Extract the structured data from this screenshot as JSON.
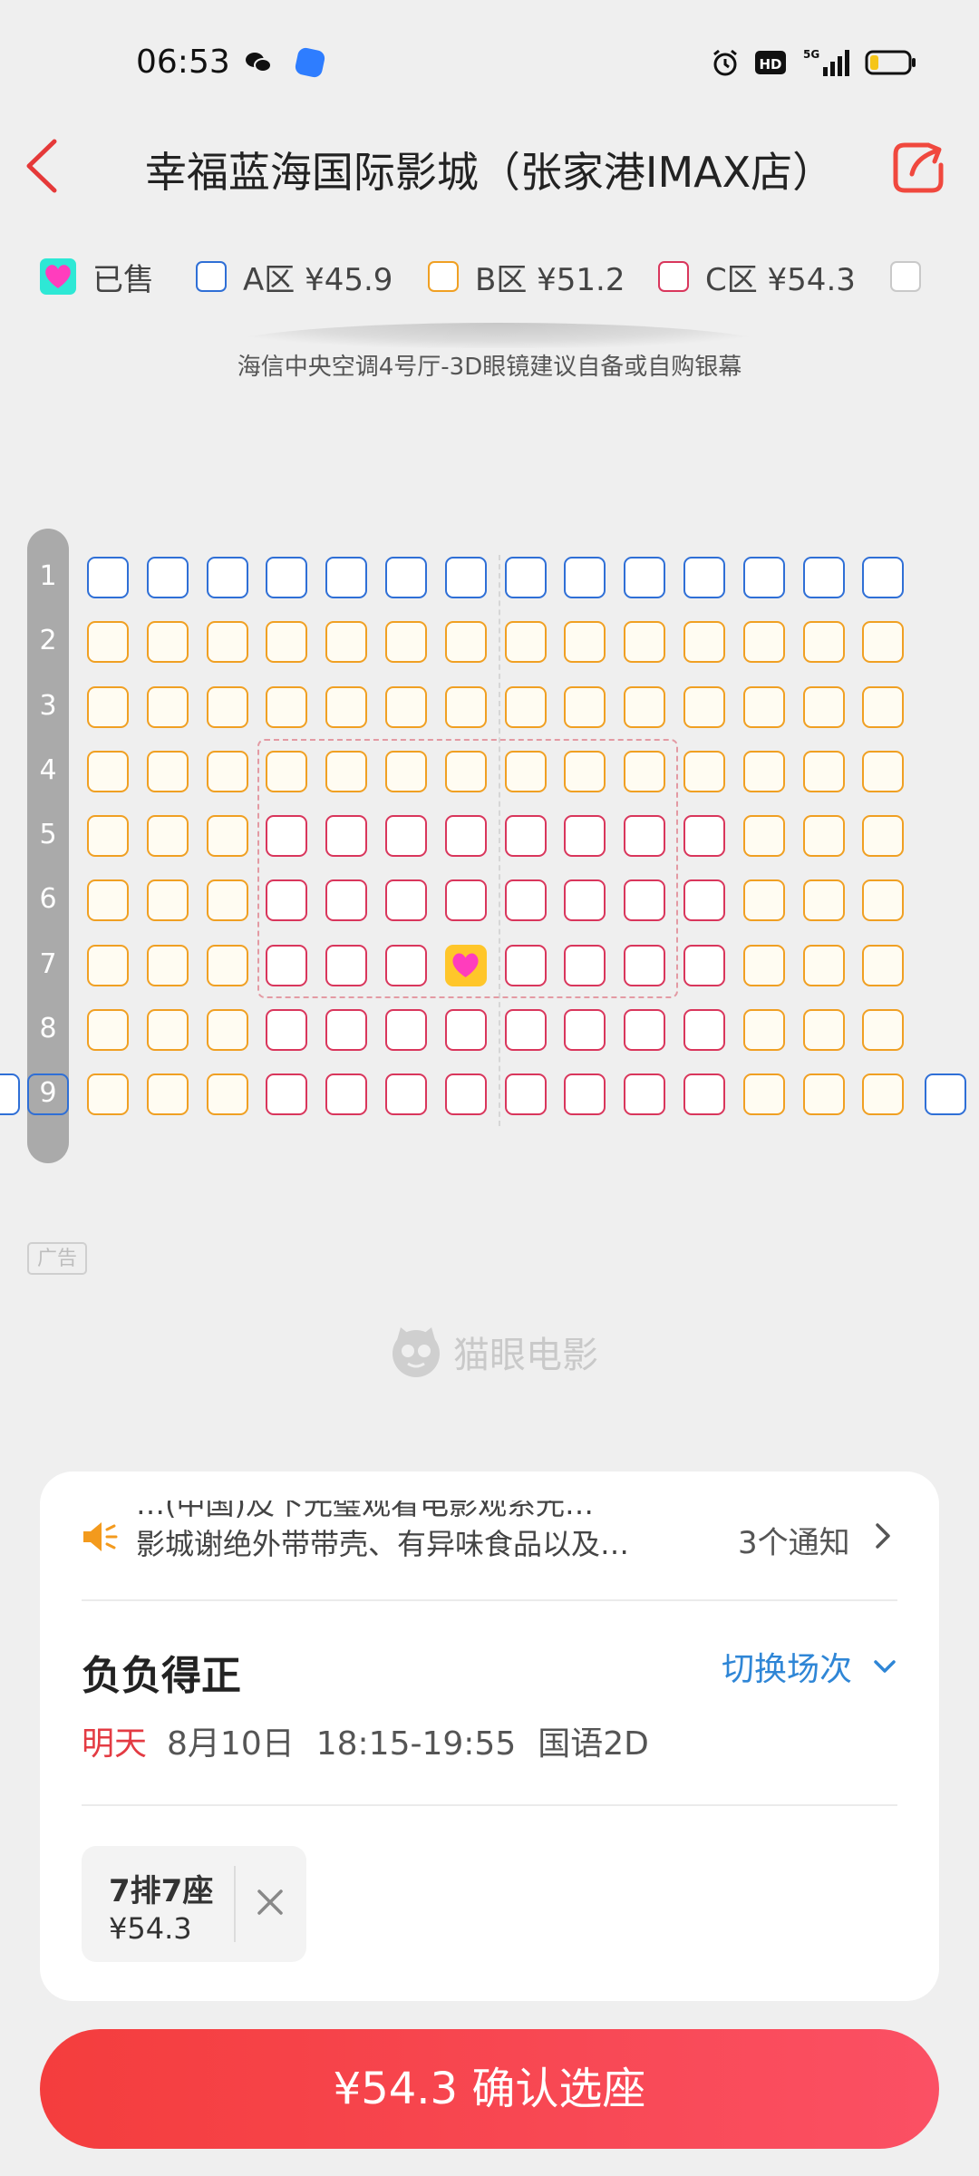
{
  "status_bar": {
    "time": "06:53",
    "network": "5G",
    "hd_badge": "HD"
  },
  "header": {
    "title": "幸福蓝海国际影城（张家港IMAX店）"
  },
  "legend": [
    {
      "label": "已售",
      "type": "sold"
    },
    {
      "label": "A区 ¥45.9",
      "type": "A",
      "color": "#2f6fd6"
    },
    {
      "label": "B区 ¥51.2",
      "type": "B",
      "color": "#f0a023"
    },
    {
      "label": "C区 ¥54.3",
      "type": "C",
      "color": "#d9365c"
    },
    {
      "label": "",
      "type": "other"
    }
  ],
  "screen": {
    "label": "海信中央空调4号厅-3D眼镜建议自备或自购银幕"
  },
  "seat_map": {
    "rows": [
      {
        "number": "1",
        "seats": "AAAAAAAAAAAAAA"
      },
      {
        "number": "2",
        "seats": "BBBBBBBBBBBBBB"
      },
      {
        "number": "3",
        "seats": "BBBBBBBBBBBBBB"
      },
      {
        "number": "4",
        "seats": "BBBBBBBBBBBBBB"
      },
      {
        "number": "5",
        "seats": "BBBCCCCCCCCBBB"
      },
      {
        "number": "6",
        "seats": "BBBCCCCCCCCBBB"
      },
      {
        "number": "7",
        "seats": "BBBCCCSCCCCBBB"
      },
      {
        "number": "8",
        "seats": "BBBCCCCCCCCBBB"
      },
      {
        "number": "9",
        "seats": "BBBCCCCCCCCBBB"
      }
    ],
    "sold_seat": {
      "row": 7,
      "seat": 7
    }
  },
  "ad": {
    "label": "广告"
  },
  "watermark": {
    "label": "猫眼电影"
  },
  "notice": {
    "line1": "…(中国)及下光璧观看电影观系光…",
    "line2": "影城谢绝外带带壳、有异味食品以及…",
    "count": "3个通知"
  },
  "movie": {
    "title": "负负得正",
    "switch_label": "切换场次",
    "day": "明天",
    "date": "8月10日",
    "time": "18:15-19:55",
    "format": "国语2D"
  },
  "selected_ticket": {
    "seat": "7排7座",
    "price": "¥54.3"
  },
  "confirm": {
    "label": "¥54.3 确认选座"
  },
  "colors": {
    "accent": "#f43d3d",
    "link": "#2f86d6",
    "sold": "#ffc62a",
    "heart": "#ff3dbd"
  }
}
